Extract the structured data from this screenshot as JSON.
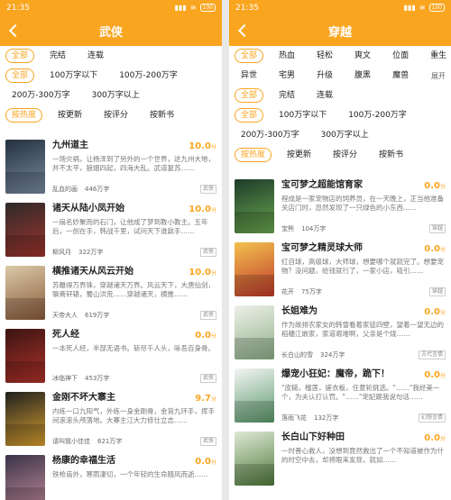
{
  "left": {
    "status": {
      "time": "21:35",
      "battery": "100"
    },
    "title": "武侠",
    "filters": [
      [
        {
          "label": "全部",
          "selected": true
        },
        {
          "label": "完结",
          "selected": false
        },
        {
          "label": "连载",
          "selected": false
        }
      ],
      [
        {
          "label": "全部",
          "selected": true
        },
        {
          "label": "100万字以下",
          "selected": false
        },
        {
          "label": "100万-200万字",
          "selected": false
        }
      ],
      [
        {
          "label": "200万-300万字",
          "selected": false
        },
        {
          "label": "300万字以上",
          "selected": false
        }
      ],
      [
        {
          "label": "按热度",
          "selected": true
        },
        {
          "label": "按更新",
          "selected": false
        },
        {
          "label": "按评分",
          "selected": false
        },
        {
          "label": "按新书",
          "selected": false
        }
      ]
    ],
    "books": [
      {
        "title": "九州道主",
        "score": "10.0",
        "unit": "分",
        "desc": "一场灾祸，让杨泽到了另外的一个世界，这九州大地，并不太平，狼烟四起，四海大乱。武道复苏……",
        "author": "乱血的画",
        "words": "446万字",
        "tag": "武侠",
        "cover": [
          "#24303e",
          "#7a8ba0"
        ]
      },
      {
        "title": "诸天从陆小凤开始",
        "score": "10.0",
        "unit": "分",
        "desc": "一扇名妙聚而的石门，让他成了梦到教小教主。五年后，一创在手，韩战千里，试问天下谁敌手……",
        "author": "柳风月",
        "words": "322万字",
        "tag": "武侠",
        "cover": [
          "#2d2a2a",
          "#a0342c"
        ]
      },
      {
        "title": "横推诸天从风云开始",
        "score": "10.0",
        "unit": "分",
        "desc": "苏離得万界珠，穿越诸天万界。风云天下，大唐仙剑，聊斋轩辕，蜀山洪荒……穿越诸天，横推……",
        "author": "天帝大人",
        "words": "619万字",
        "tag": "武侠",
        "cover": [
          "#d9c9a8",
          "#8a5a3a"
        ]
      },
      {
        "title": "死人经",
        "score": "0.0",
        "unit": "分",
        "desc": "一本死人经，半部无语书。斩尽千人头，咏吾百身骨。",
        "author": "冰临神下",
        "words": "453万字",
        "tag": "武侠",
        "cover": [
          "#3a1512",
          "#b0312a"
        ]
      },
      {
        "title": "金刚不坏大寨主",
        "score": "9.7",
        "unit": "分",
        "desc": "内练一口九阳气，外练一身金刚骨，金背九环手，挥手间滚滚头颅落地。大寨主江大力修仕立志……",
        "author": "请叫我小佳佳",
        "words": "621万字",
        "tag": "武侠",
        "cover": [
          "#1f1f1f",
          "#d8a030"
        ]
      },
      {
        "title": "杨康的幸福生活",
        "score": "0.0",
        "unit": "分",
        "desc": "铁枪庙外，寒雨凄切，一个年轻的生命随风而逝……",
        "author": "",
        "words": "",
        "tag": "",
        "cover": [
          "#3a3348",
          "#c08a9a"
        ]
      }
    ]
  },
  "right": {
    "status": {
      "time": "21:35",
      "battery": "100"
    },
    "title": "穿越",
    "filters": [
      [
        {
          "label": "全部",
          "selected": true
        },
        {
          "label": "热血",
          "selected": false
        },
        {
          "label": "轻松",
          "selected": false
        },
        {
          "label": "爽文",
          "selected": false
        },
        {
          "label": "位面",
          "selected": false
        },
        {
          "label": "重生",
          "selected": false
        }
      ],
      [
        {
          "label": "异世",
          "selected": false
        },
        {
          "label": "宅男",
          "selected": false
        },
        {
          "label": "升级",
          "selected": false
        },
        {
          "label": "腹黑",
          "selected": false
        },
        {
          "label": "魔兽",
          "selected": false
        }
      ],
      [
        {
          "label": "全部",
          "selected": true
        },
        {
          "label": "完结",
          "selected": false
        },
        {
          "label": "连载",
          "selected": false
        }
      ],
      [
        {
          "label": "全部",
          "selected": true
        },
        {
          "label": "100万字以下",
          "selected": false
        },
        {
          "label": "100万-200万字",
          "selected": false
        }
      ],
      [
        {
          "label": "200万-300万字",
          "selected": false
        },
        {
          "label": "300万字以上",
          "selected": false
        }
      ],
      [
        {
          "label": "按热度",
          "selected": true
        },
        {
          "label": "按更新",
          "selected": false
        },
        {
          "label": "按评分",
          "selected": false
        },
        {
          "label": "按新书",
          "selected": false
        }
      ]
    ],
    "expand_label": "展开",
    "books": [
      {
        "title": "宝可梦之超能馆育家",
        "score": "0.0",
        "unit": "分",
        "desc": "程成是一家宠物店的饲养员，在一天晚上，正当他准备关店门时，忽然发现了一只绿色的小东西……",
        "author": "宝熊",
        "words": "104万字",
        "tag": "穿越",
        "cover": [
          "#1e3b2a",
          "#6aa84f"
        ]
      },
      {
        "title": "宝可梦之精灵球大师",
        "score": "0.0",
        "unit": "分",
        "desc": "红自球，高级球，大师球，想要哪个就就完了。想要宠物？没问题，给钱就行了，一家小店，吸引……",
        "author": "花开",
        "words": "75万字",
        "tag": "穿越",
        "cover": [
          "#f2c14e",
          "#c0392b"
        ]
      },
      {
        "title": "长姐难为",
        "score": "0.0",
        "unit": "分",
        "desc": "作为故排农家女的韩雪看着家徒四壁，望着一望无边的稻穗江嵌家，家道艰难啊，父亲是个烧……",
        "author": "长白山的雪",
        "words": "324万字",
        "tag": "古代言情",
        "cover": [
          "#eef0e8",
          "#8fb08a"
        ]
      },
      {
        "title": "爆宠小狂妃：魔帝，跪下！",
        "score": "0.0",
        "unit": "分",
        "desc": "\"皮糙，榴莲，搓衣板，任意轮挑选。\"……\"我经美一个，为夫认打认罚。\"……\"宠妃跟我说句话……",
        "author": "落雨飞花",
        "words": "132万字",
        "tag": "幻想言情",
        "cover": [
          "#f4f4f4",
          "#5a9a6a"
        ]
      },
      {
        "title": "长白山下好种田",
        "score": "0.0",
        "unit": "分",
        "desc": "一时善心救人，没想到竟然救出了一个不知道被作为什的时空中去，却将眼来发现，就如……",
        "author": "",
        "words": "",
        "tag": "",
        "cover": [
          "#dfe9d6",
          "#4f7a3a"
        ]
      }
    ]
  }
}
